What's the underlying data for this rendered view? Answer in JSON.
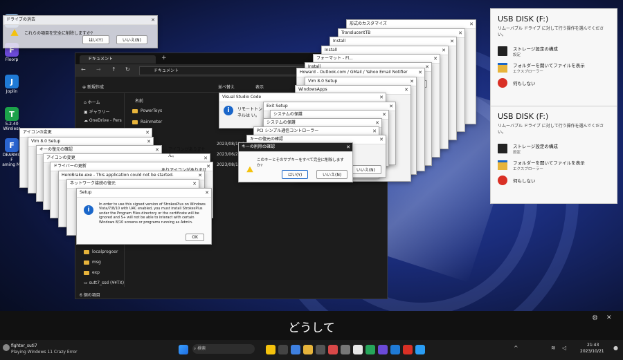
{
  "desktop_icons": [
    {
      "label": "Floorp",
      "color": "#6b4ad8",
      "glyph": "F"
    },
    {
      "label": "Joplin",
      "color": "#1f7ad6",
      "glyph": "J"
    },
    {
      "label": "5.2.40 Wireless",
      "color": "#1ca24a",
      "glyph": "T"
    },
    {
      "label": "DEARMO F",
      "color": "#2a64d0",
      "glyph": "F"
    },
    {
      "label": "aming Mi",
      "color": "",
      "glyph": ""
    }
  ],
  "top_left_dialog": {
    "title": "ドライブの消去",
    "message": "これらの項目を完全に削除しますか?",
    "yes": "はい(Y)",
    "no": "いいえ(N)"
  },
  "explorer": {
    "tab_title": "ドキュメント",
    "address": "ドキュメント",
    "new_button": "新規作成",
    "sort_label": "並べ替え",
    "view_label": "表示",
    "sidebar": [
      "ホーム",
      "ギャラリー",
      "OneDrive - Pers"
    ],
    "column_name": "名前",
    "folders": [
      "PowerToys",
      "Rainmeter"
    ],
    "lower_folders": [
      "localprogoor",
      "msg",
      "exp",
      "sutt7_ssd (¥¥TX)"
    ],
    "dates": [
      "2023/08/11 0",
      "2023/06/23 1",
      "2023/08/13 1"
    ],
    "status": "6 個の項目"
  },
  "dialogs_left": [
    {
      "title": "アイコンの変更"
    },
    {
      "title": "Vim 8.0 Setup"
    },
    {
      "title": "キーの復元の確認"
    },
    {
      "title": "アイコンの変更",
      "message": "アイコンがありません。"
    },
    {
      "title": "ドライバーの更新",
      "message": "ありアイコンがありません。"
    },
    {
      "title": "HeroBrake.exe - This application could not be started."
    },
    {
      "title": "ネットワーク接続の復元"
    }
  ],
  "setup_dialog": {
    "title": "Setup",
    "message": "In order to use this signed version of StrokesPlus on Windows Vista/7/8/10 with UAC enabled, you must install StrokesPlus under the Program Files directory or the certificate will be ignored and S+ will not be able to interact with certain Windows 8/10 screens or programs running as Admin.",
    "ok": "OK"
  },
  "dialogs_right": [
    {
      "title": "形式のカスタマイズ"
    },
    {
      "title": "TranslucentTB"
    },
    {
      "title": "Install"
    },
    {
      "title": "Install"
    },
    {
      "title": "フォーマット - Fl..."
    },
    {
      "title": "Install"
    },
    {
      "title": "Howard - Outlook.com / GMail / Yahoo Email Notifier"
    },
    {
      "title": "Vim 8.0 Setup"
    },
    {
      "title": "WindowsApps"
    }
  ],
  "dialogs_center": [
    {
      "title": "Visual Studio Code",
      "message": "リモートトンネルは い。"
    },
    {
      "title": "Exit Setup"
    },
    {
      "title": "システムの保護"
    },
    {
      "title": "システムの保護"
    },
    {
      "title": "PCI シンプル通信コントローラー"
    },
    {
      "title": "キーの復元の確認"
    }
  ],
  "delete_key_dialog": {
    "title": "キーの削除の確認",
    "message": "このキーとそのサブキーをすべて完全に削除しますか?",
    "yes": "はい(Y)",
    "no": "いいえ(N)",
    "behind_no": "いいえ(N)"
  },
  "usb_panels": [
    {
      "title": "USB DISK (F:)",
      "subtitle": "リムーバブル ドライブ に対して行う操作を選んでください。",
      "options": [
        {
          "label": "ストレージ設定の構成",
          "sub": "設定",
          "icon": "storage-icon"
        },
        {
          "label": "フォルダーを開いてファイルを表示",
          "sub": "エクスプローラー",
          "icon": "folder-icon"
        },
        {
          "label": "何もしない",
          "sub": "",
          "icon": "no-entry-icon"
        }
      ]
    },
    {
      "title": "USB DISK (F:)",
      "subtitle": "リムーバブル ドライブ に対して行う操作を選んでください。",
      "options": [
        {
          "label": "ストレージ設定の構成",
          "sub": "設定",
          "icon": "storage-icon"
        },
        {
          "label": "フォルダーを開いてファイルを表示",
          "sub": "エクスプローラー",
          "icon": "folder-icon"
        },
        {
          "label": "何もしない",
          "sub": "",
          "icon": "no-entry-icon"
        }
      ]
    }
  ],
  "subtitle": "どうして",
  "taskbar": {
    "channel": "fighter_suti7",
    "status": "Playing Windows 11 Crazy Error",
    "time": "21:43",
    "date": "2023/10/21",
    "search": "検索"
  },
  "colors": {
    "accent": "#1a66c9",
    "warning": "#f4c20d",
    "no_entry": "#d93025"
  }
}
